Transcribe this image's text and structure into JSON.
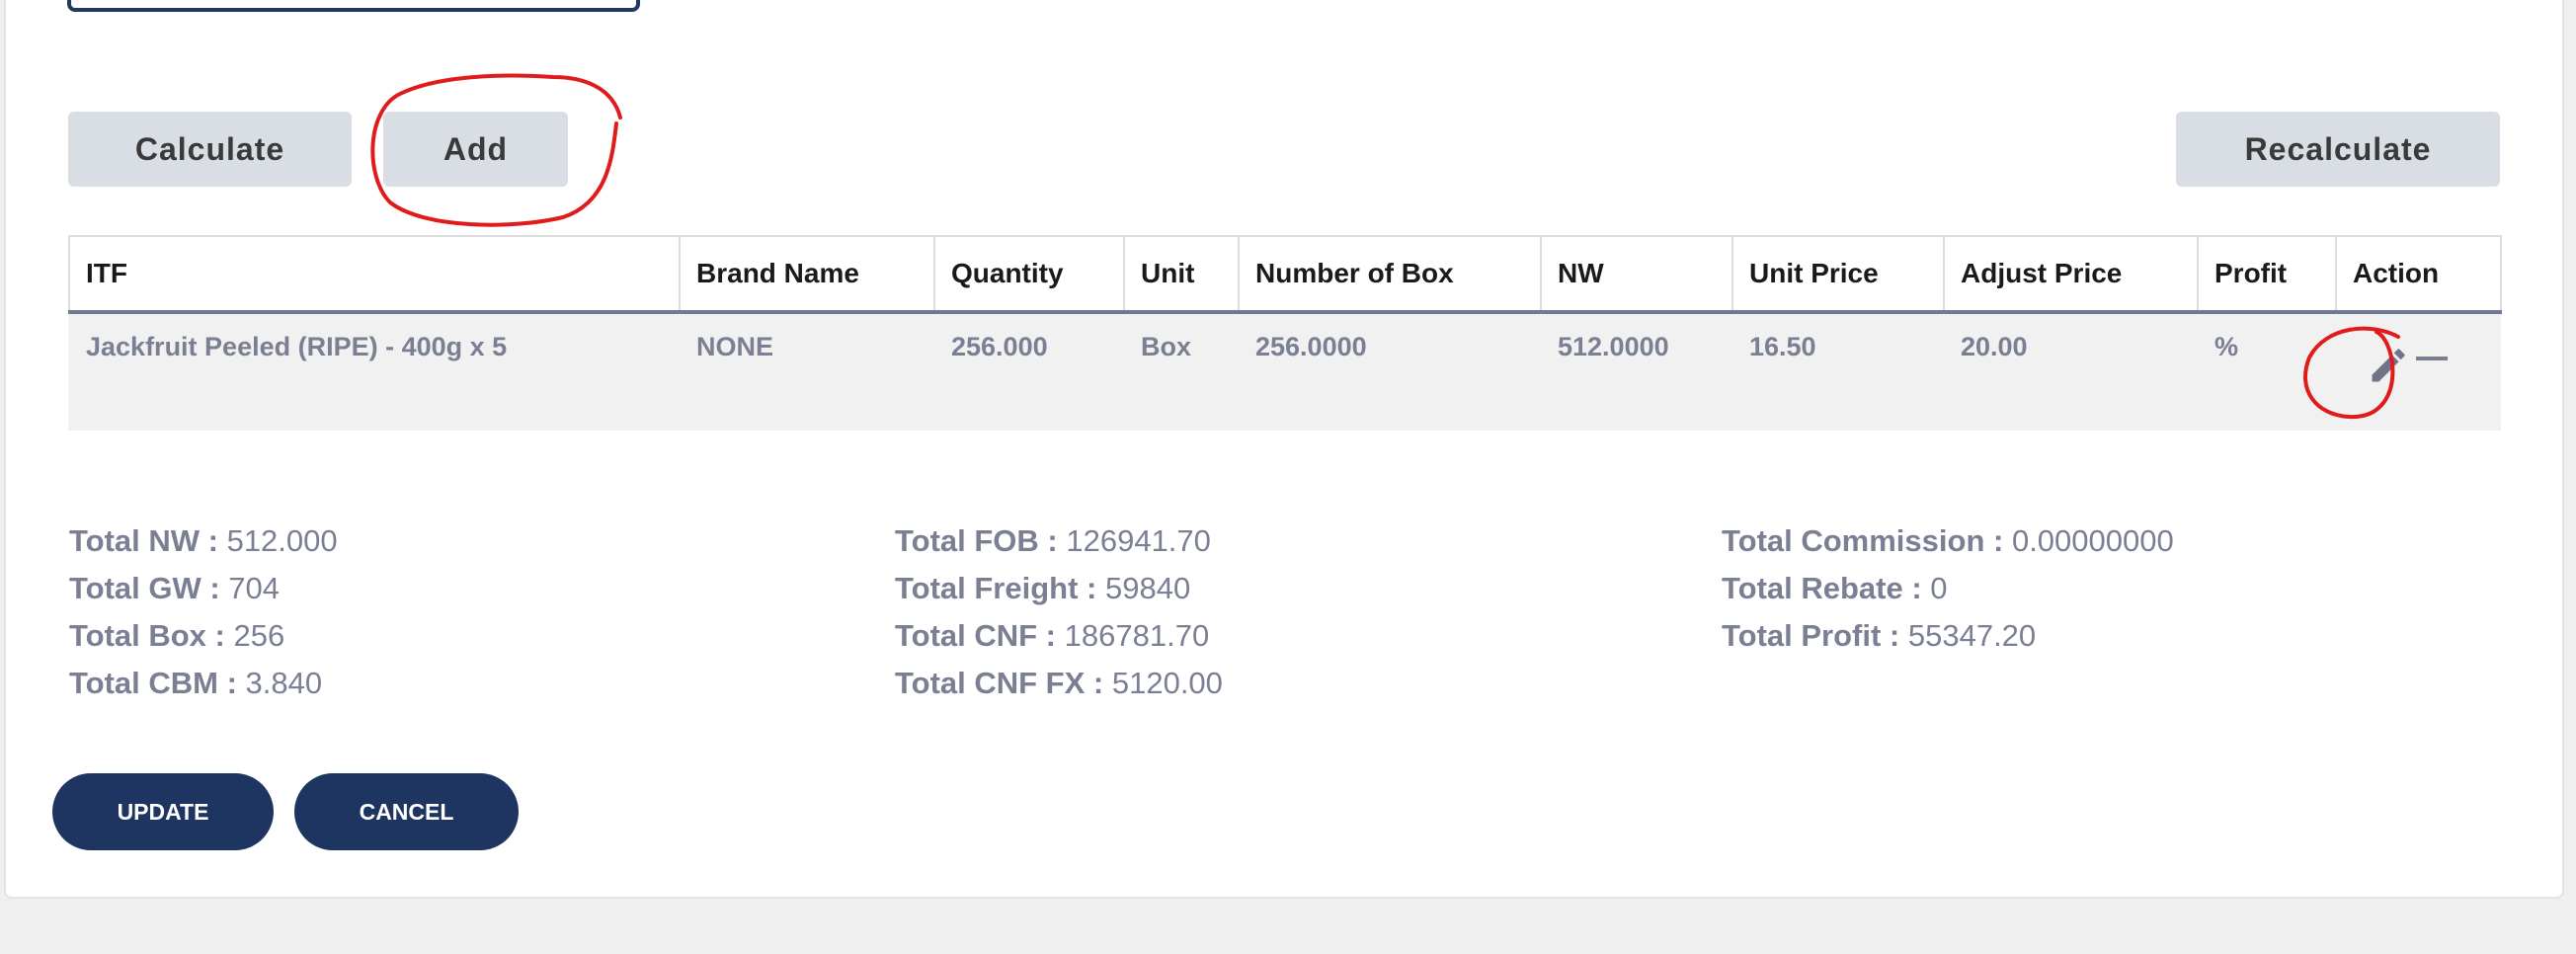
{
  "toolbar": {
    "calculate_label": "Calculate",
    "add_label": "Add",
    "recalculate_label": "Recalculate"
  },
  "table": {
    "headers": [
      "ITF",
      "Brand Name",
      "Quantity",
      "Unit",
      "Number of Box",
      "NW",
      "Unit Price",
      "Adjust Price",
      "Profit",
      "Action"
    ],
    "rows": [
      {
        "itf": "Jackfruit Peeled (RIPE) - 400g x 5",
        "brand": "NONE",
        "quantity": "256.000",
        "unit": "Box",
        "boxes": "256.0000",
        "nw": "512.0000",
        "unit_price": "16.50",
        "adjust_price": "20.00",
        "profit": "%",
        "actions": [
          "edit-icon",
          "remove-icon"
        ]
      }
    ]
  },
  "totals": {
    "col1": [
      {
        "label": "Total NW :",
        "value": "512.000"
      },
      {
        "label": "Total GW :",
        "value": "704"
      },
      {
        "label": "Total Box :",
        "value": "256"
      },
      {
        "label": "Total CBM :",
        "value": "3.840"
      }
    ],
    "col2": [
      {
        "label": "Total FOB :",
        "value": "126941.70"
      },
      {
        "label": "Total Freight :",
        "value": "59840"
      },
      {
        "label": "Total CNF :",
        "value": "186781.70"
      },
      {
        "label": "Total CNF FX :",
        "value": "5120.00"
      }
    ],
    "col3": [
      {
        "label": "Total Commission :",
        "value": "0.00000000"
      },
      {
        "label": "Total Rebate :",
        "value": "0"
      },
      {
        "label": "Total Profit :",
        "value": "55347.20"
      }
    ]
  },
  "footer": {
    "update_label": "UPDATE",
    "cancel_label": "CANCEL"
  },
  "colors": {
    "primary": "#1e3461",
    "secondary_button": "#d9dde4",
    "muted_text": "#7a7f94",
    "annotation": "#e01b1b"
  }
}
